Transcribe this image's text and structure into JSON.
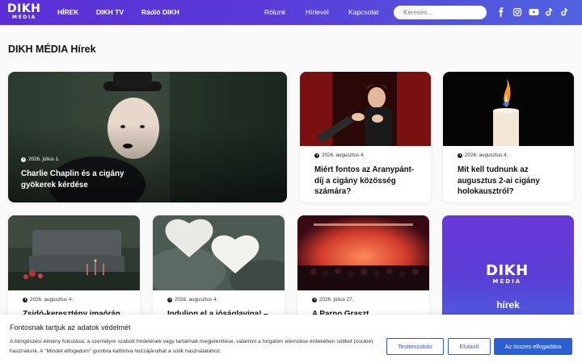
{
  "header": {
    "logo_main": "DIKH",
    "logo_sub": "MEDIA",
    "nav": [
      "HÍREK",
      "DIKH TV",
      "Rádió DIKH"
    ],
    "nav_right": [
      "Rólunk",
      "Hírlevél",
      "Kapcsolat"
    ],
    "search_placeholder": "Keresés...",
    "social_icons": [
      "facebook-icon",
      "instagram-icon",
      "youtube-icon",
      "tiktok-icon",
      "tiktok-icon"
    ]
  },
  "page": {
    "title": "DIKH MÉDIA Hírek"
  },
  "articles": [
    {
      "date": "2026. július 1.",
      "title": "Charlie Chaplin és a cigány gyökerek kérdése"
    },
    {
      "date": "2026. augusztus 4.",
      "title": "Miért fontos az Aranypánt-díj a cigány közösség számára?"
    },
    {
      "date": "2026. augusztus 4.",
      "title": "Mit kell tudnunk az augusztus 2-ai cigány holokausztról?"
    },
    {
      "date": "2026. augusztus 4.",
      "title": "Zsidó-keresztény imaórán"
    },
    {
      "date": "2026. augusztus 4.",
      "title": "Indulion el a jóságlavina! –"
    },
    {
      "date": "2026. július 27.",
      "title": "A Parno Graszt"
    }
  ],
  "promo": {
    "logo_main": "DIKH",
    "logo_sub": "MEDIA",
    "label": "hírek"
  },
  "cookie": {
    "title": "Fontosnak tartjuk az adatok védelmét",
    "text": "A böngészési élmény fokozása, a személyre szabott hirdetések vagy tartalmak megjelenítése, valamint a forgalom elemzése érdekében sütiket (cookie) használunk. A \"Mindet elfogadom\" gombra kattintva hozzájárulhat a sütik használatához.",
    "btn_customize": "Testreszabás",
    "btn_reject": "Elutasít",
    "btn_accept": "Az összes elfogadása"
  },
  "colors": {
    "header_start": "#5a2fd6",
    "header_end": "#4f63e0",
    "accent": "#2c5fd3"
  }
}
